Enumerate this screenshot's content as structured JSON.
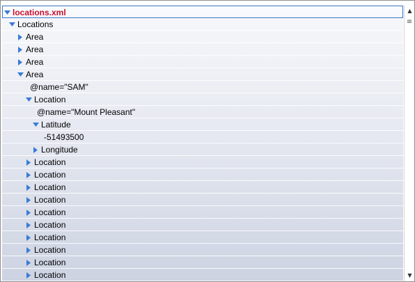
{
  "tree": {
    "nodes": [
      {
        "label": "locations.xml",
        "depth": 0,
        "expander": "expanded",
        "selected": true
      },
      {
        "label": "Locations",
        "depth": 1,
        "expander": "expanded"
      },
      {
        "label": "Area",
        "depth": 2,
        "expander": "collapsed"
      },
      {
        "label": "Area",
        "depth": 2,
        "expander": "collapsed"
      },
      {
        "label": "Area",
        "depth": 2,
        "expander": "collapsed"
      },
      {
        "label": "Area",
        "depth": 2,
        "expander": "expanded"
      },
      {
        "label": "@name=\"SAM\"",
        "depth": 3,
        "expander": "none"
      },
      {
        "label": "Location",
        "depth": 3,
        "expander": "expanded"
      },
      {
        "label": "@name=\"Mount Pleasant\"",
        "depth": 4,
        "expander": "none"
      },
      {
        "label": "Latitude",
        "depth": 4,
        "expander": "expanded"
      },
      {
        "label": "-51493500",
        "depth": 5,
        "expander": "none"
      },
      {
        "label": "Longitude",
        "depth": 4,
        "expander": "collapsed"
      },
      {
        "label": "Location",
        "depth": 3,
        "expander": "collapsed"
      },
      {
        "label": "Location",
        "depth": 3,
        "expander": "collapsed"
      },
      {
        "label": "Location",
        "depth": 3,
        "expander": "collapsed"
      },
      {
        "label": "Location",
        "depth": 3,
        "expander": "collapsed"
      },
      {
        "label": "Location",
        "depth": 3,
        "expander": "collapsed"
      },
      {
        "label": "Location",
        "depth": 3,
        "expander": "collapsed"
      },
      {
        "label": "Location",
        "depth": 3,
        "expander": "collapsed"
      },
      {
        "label": "Location",
        "depth": 3,
        "expander": "collapsed"
      },
      {
        "label": "Location",
        "depth": 3,
        "expander": "collapsed"
      },
      {
        "label": "Location",
        "depth": 3,
        "expander": "collapsed"
      }
    ]
  },
  "scrollbar": {
    "up_icon": "▲",
    "down_icon": "▼",
    "grip_icon": "≡"
  },
  "colors": {
    "twisty": "#3a7bd5",
    "root_label": "#c8102e",
    "selection_border": "#3b74c6"
  }
}
